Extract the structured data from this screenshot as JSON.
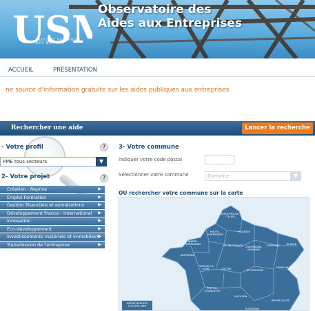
{
  "banner": {
    "logo_text": "USM",
    "logo_subtitle": "INSTITUT SUPERIEUR DES MÉTIERS",
    "title_line1": "Observatoire des",
    "title_line2": "Aides aux Entreprises"
  },
  "nav": {
    "items": [
      "ACCUEIL",
      "PRÉSENTATION"
    ]
  },
  "tagline": "ne source d'information gratuite sur les aides publiques aux entreprises",
  "search": {
    "label": "Rechercher une aide",
    "button": "Lancer la recherche"
  },
  "profil": {
    "title": "- Votre profil",
    "help": "?",
    "selected": "PME tous secteurs"
  },
  "projet": {
    "title": "2- Votre projet",
    "help": "?",
    "items": [
      "Création - Reprise",
      "Emploi-Formation",
      "Gestion financière et exonérations",
      "Développement France - International",
      "Innovation",
      "Eco-développement",
      "Investissements matériels et immobiliers",
      "Transmission de l'entreprise"
    ]
  },
  "commune": {
    "title": "3- Votre commune",
    "postal_label": "Indiquer votre code postal",
    "postal_value": "",
    "commune_label": "Sélectionner votre commune",
    "commune_placeholder": "Domaine",
    "map_title": "OU rechercher votre commune sur la carte",
    "regions": [
      "NORD PAS-DE-CALAIS",
      "HAUTE-NORMANDIE",
      "PICARDIE",
      "BASSE-NORMANDIE",
      "ILE-DE-FRANCE",
      "CHAMPAGNE-ARDENNE",
      "LORRAINE",
      "ALSACE",
      "BRETAGNE",
      "PAYS DE LA LOIRE",
      "CENTRE",
      "BOURGOGNE",
      "FRANCHE-COMTÉ",
      "POITOU-CHARENTES",
      "LIMOUSIN",
      "AUVERGNE",
      "RHONE-ALPES",
      "DÉPARTEMENTS D'OUTRE-MER"
    ]
  },
  "colors": {
    "accent": "#f07a1a",
    "navy": "#1f4c78",
    "map": "#3a6f9c"
  },
  "icons": [
    "help-icon",
    "chevron-down-icon",
    "triangle-right-icon",
    "magnifier-icon"
  ]
}
